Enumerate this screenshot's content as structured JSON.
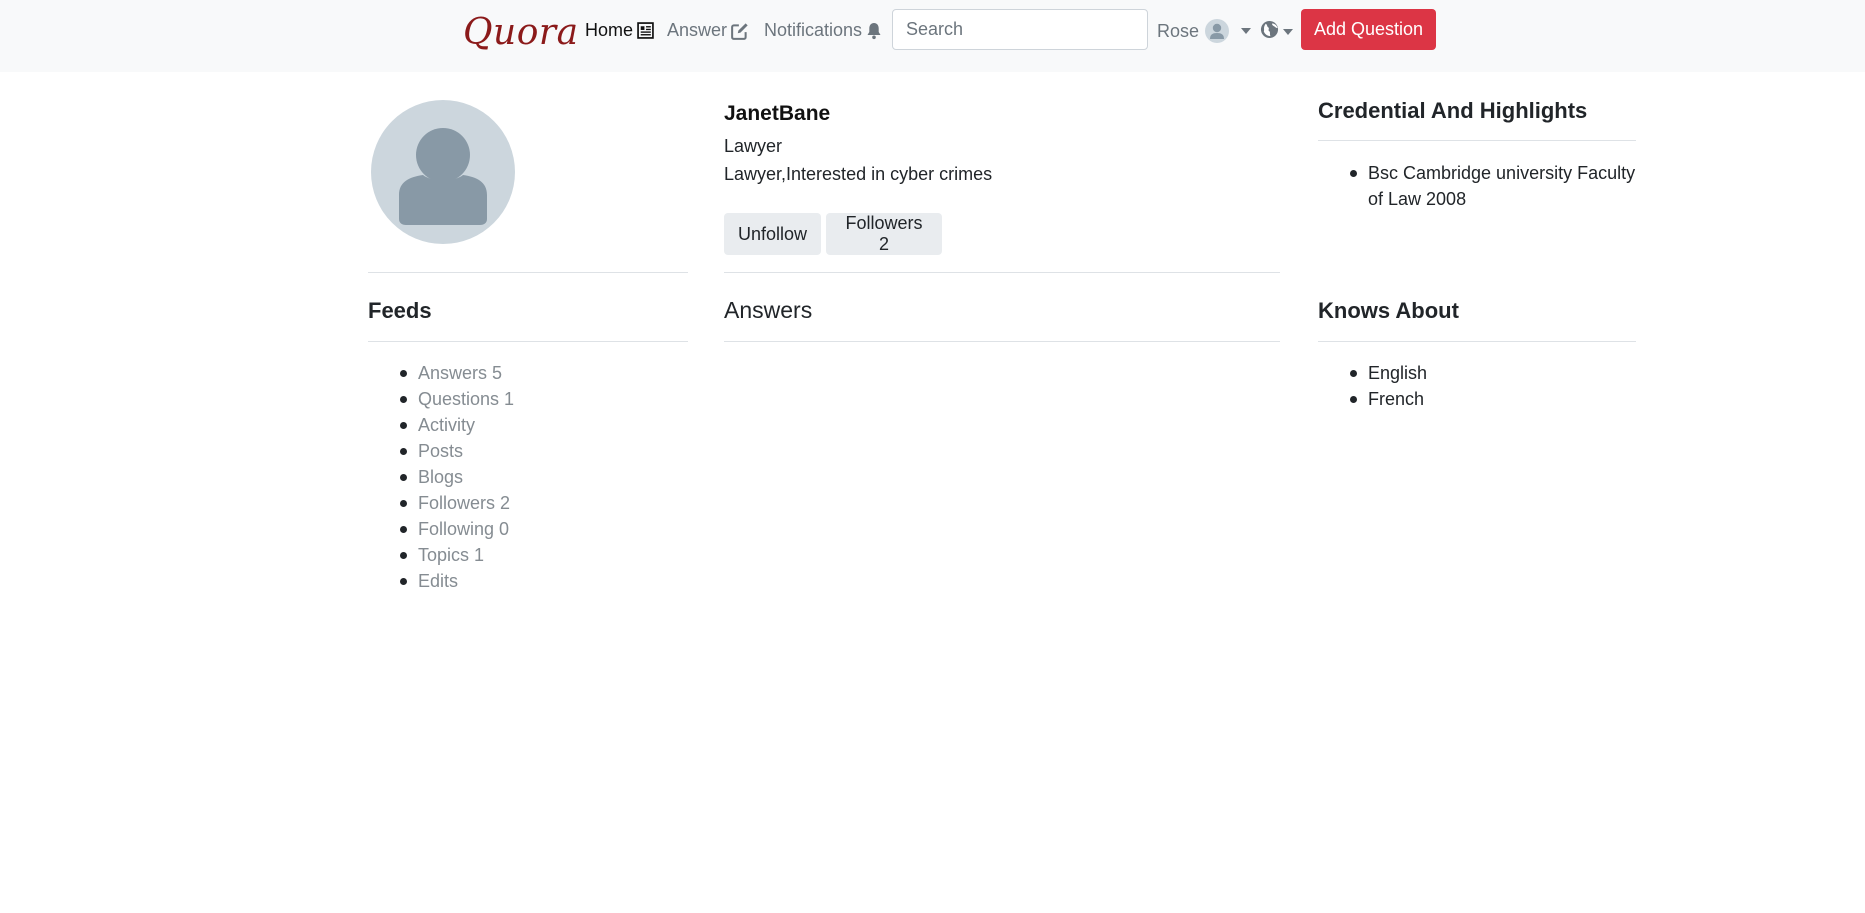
{
  "navbar": {
    "brand": "Quora",
    "home_label": "Home",
    "answer_label": "Answer",
    "notifications_label": "Notifications",
    "search_placeholder": "Search",
    "user_name": "Rose",
    "add_question_label": "Add Question"
  },
  "profile": {
    "name": "JanetBane",
    "title": "Lawyer",
    "description": "Lawyer,Interested in cyber crimes",
    "unfollow_label": "Unfollow",
    "followers_label": "Followers 2"
  },
  "feeds": {
    "title": "Feeds",
    "items": [
      {
        "label": "Answers 5"
      },
      {
        "label": "Questions 1"
      },
      {
        "label": "Activity"
      },
      {
        "label": "Posts"
      },
      {
        "label": "Blogs"
      },
      {
        "label": "Followers 2"
      },
      {
        "label": "Following 0"
      },
      {
        "label": "Topics 1"
      },
      {
        "label": "Edits"
      }
    ]
  },
  "answers": {
    "title": "Answers"
  },
  "credentials": {
    "title": "Credential And Highlights",
    "items": [
      {
        "label": "Bsc Cambridge university Faculty of Law 2008"
      }
    ]
  },
  "knows_about": {
    "title": "Knows About",
    "items": [
      {
        "label": "English"
      },
      {
        "label": "French"
      }
    ]
  },
  "colors": {
    "brand": "#8b1a1a",
    "accent_danger": "#dc3545",
    "navbar_bg": "#f8f9fa",
    "avatar_bg": "#ccd6dd",
    "avatar_fg": "#8899a6"
  },
  "icons": {
    "home": "newspaper-icon",
    "answer": "edit-icon",
    "notifications": "bell-icon",
    "language": "globe-icon",
    "avatar": "user-silhouette-icon"
  }
}
